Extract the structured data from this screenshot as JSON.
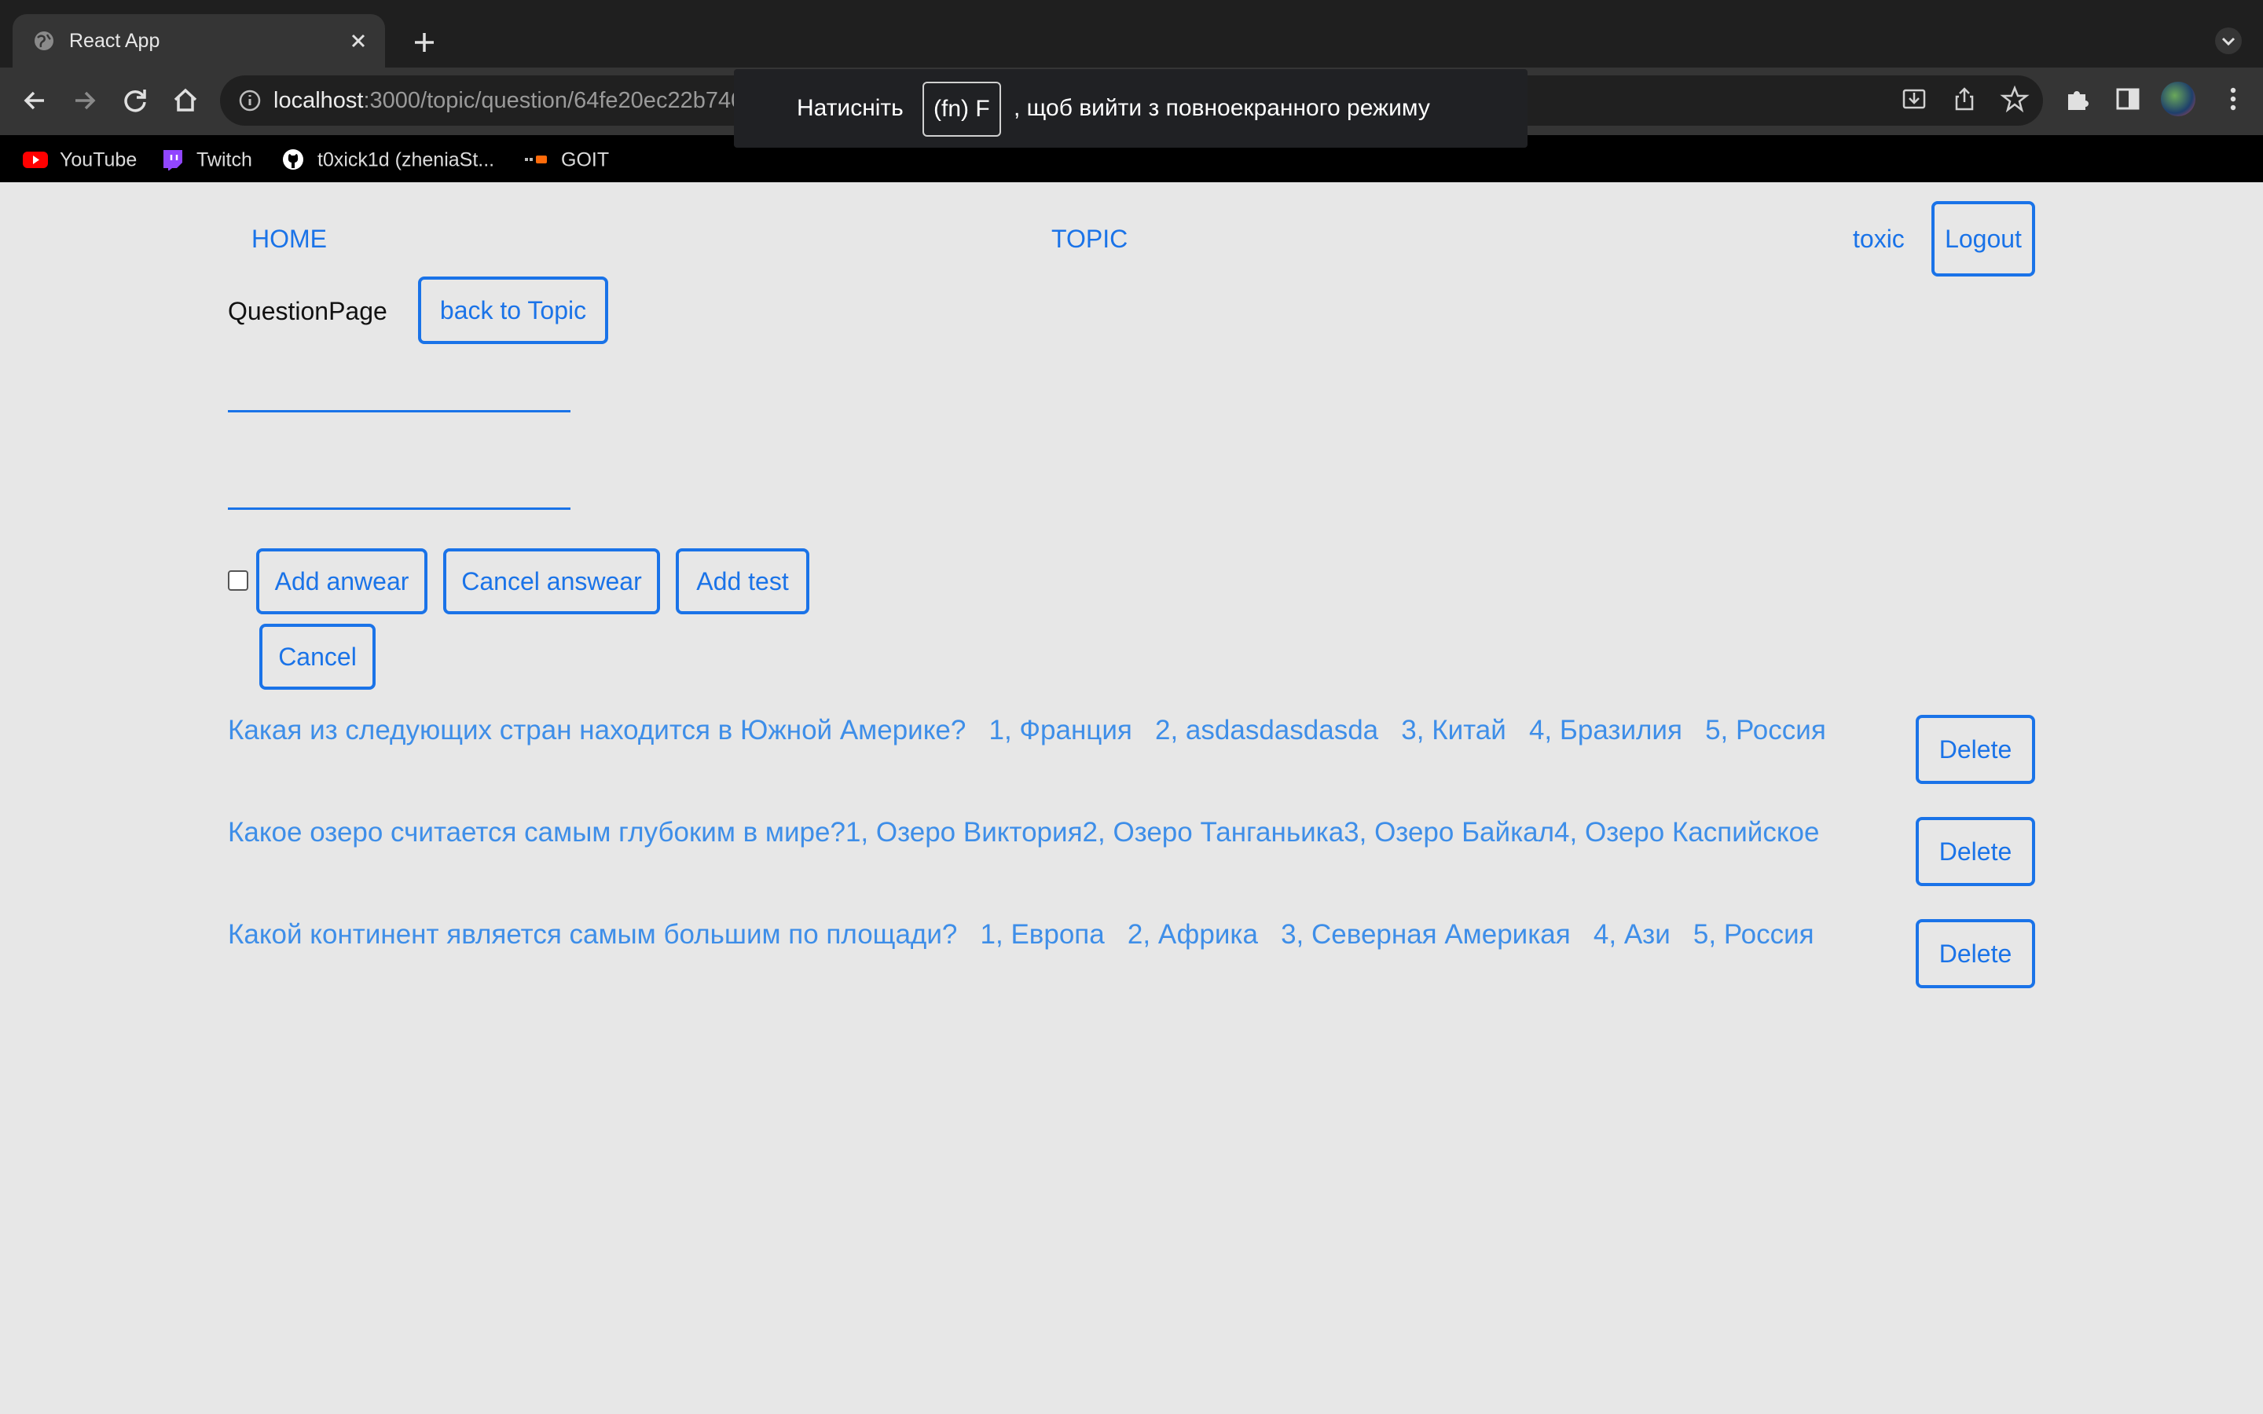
{
  "browser": {
    "tab_title": "React App",
    "url_host": "localhost",
    "url_path": ":3000/topic/question/64fe20ec22b740ff59b1cefe",
    "bookmarks": [
      {
        "label": "YouTube",
        "icon": "youtube-icon"
      },
      {
        "label": "Twitch",
        "icon": "twitch-icon"
      },
      {
        "label": "t0xick1d (zheniaSt...",
        "icon": "github-icon"
      },
      {
        "label": "GOIT",
        "icon": "goit-icon"
      }
    ],
    "fullscreen_toast": {
      "before": "Натисніть",
      "key": "(fn) F",
      "after": ", щоб вийти з повноекранного режиму"
    }
  },
  "navbar": {
    "home": "HOME",
    "topic": "TOPIC",
    "user": "toxic",
    "logout": "Logout"
  },
  "page": {
    "title": "QuestionPage",
    "back_button": "back to Topic",
    "question_input": {
      "value": "",
      "placeholder": ""
    },
    "answer_input": {
      "value": "",
      "placeholder": ""
    },
    "correct_checkbox_checked": false,
    "add_answer_button": "Add anwear",
    "cancel_answer_button": "Cancel answear",
    "add_test_button": "Add test",
    "cancel_button": "Cancel"
  },
  "questions": [
    {
      "text": "Какая из следующих стран находится в Южной Америке?   1, Франция   2, asdasdasdasda   3, Китай   4, Бразилия   5, Россия",
      "delete_label": "Delete"
    },
    {
      "text": "Какое озеро считается самым глубоким в мире?1, Озеро Виктория2, Озеро Танганьика3, Озеро Байкал4, Озеро Каспийское",
      "delete_label": "Delete"
    },
    {
      "text": "Какой континент является самым большим по площади?   1, Европа   2, Африка   3, Северная Америкая   4, Ази   5, Россия",
      "delete_label": "Delete"
    }
  ],
  "colors": {
    "accent": "#1a73e8",
    "page_background": "#e7e7e7",
    "question_text": "#3e8ee8"
  }
}
